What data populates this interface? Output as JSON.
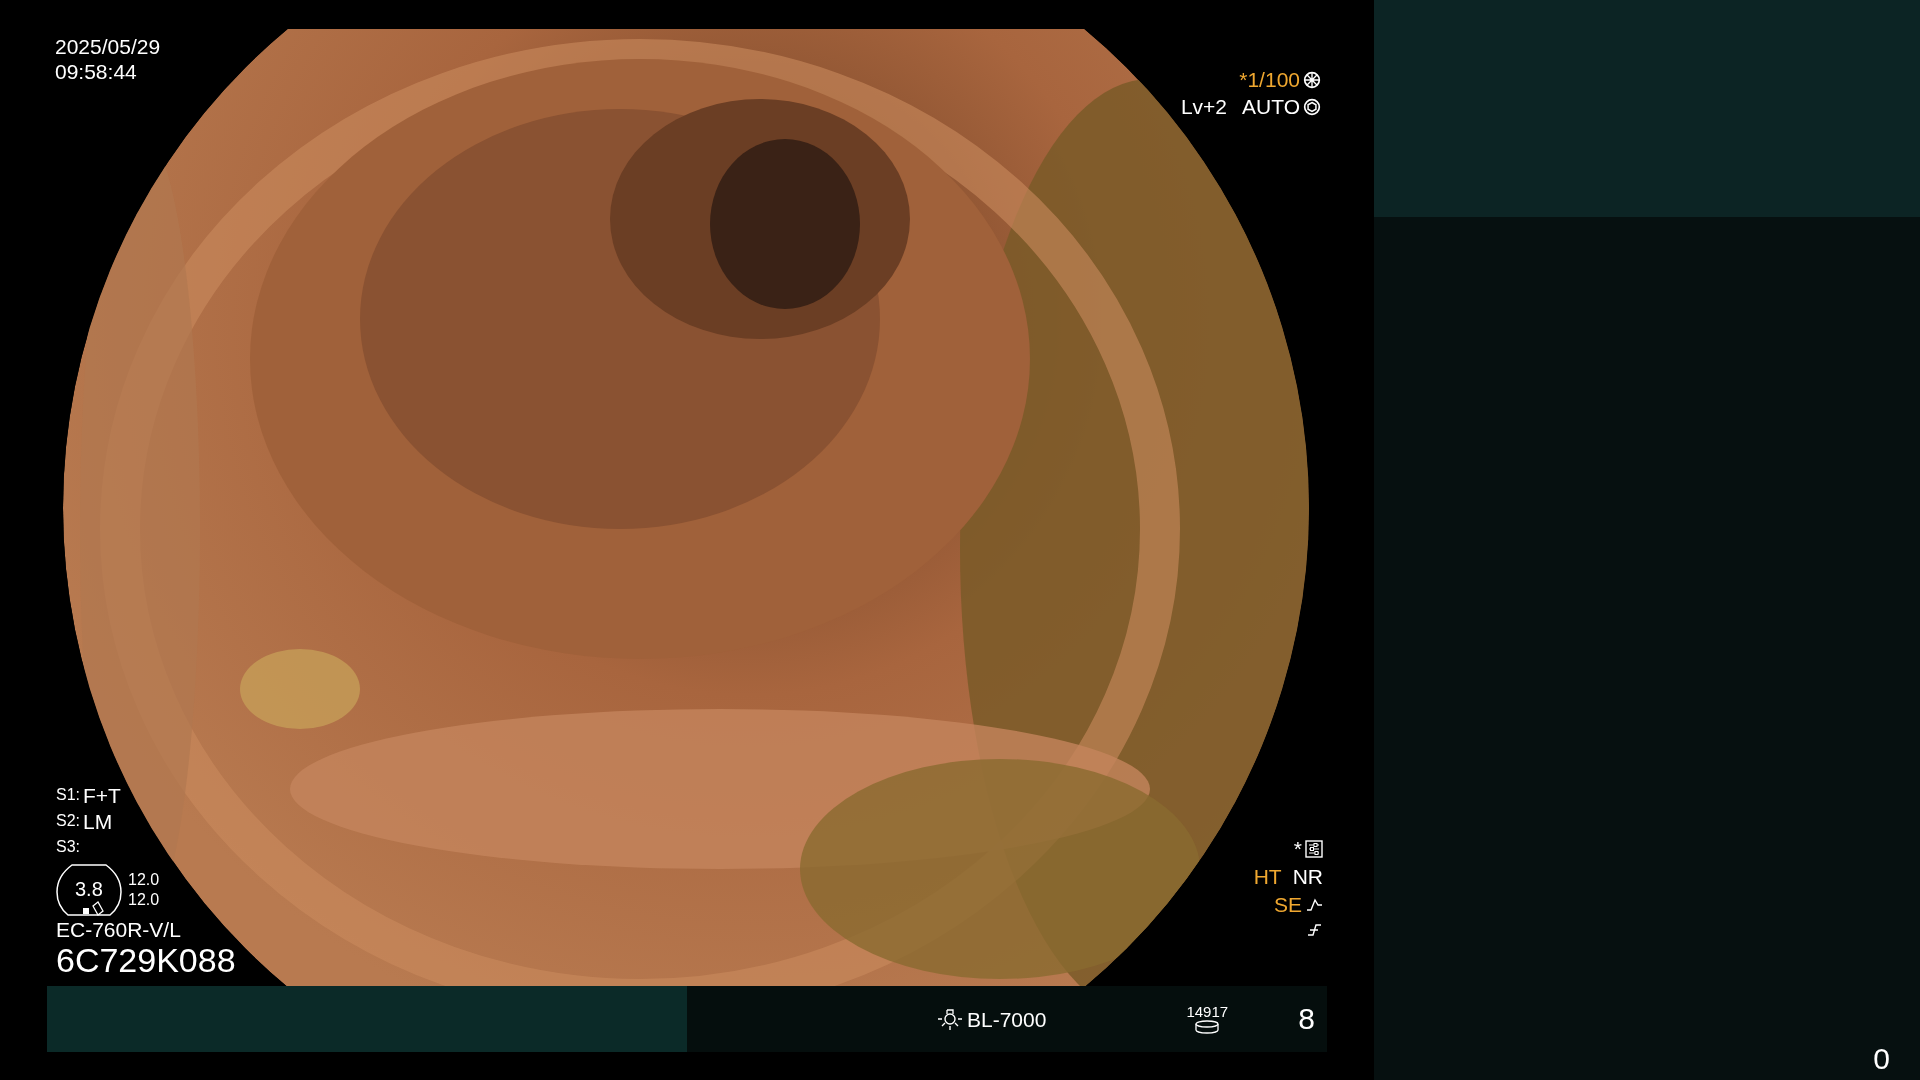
{
  "timestamp": {
    "date": "2025/05/29",
    "time": "09:58:44"
  },
  "exposure": {
    "shutter": {
      "text": "*1/100",
      "highlighted": true
    },
    "level": "Lv+2",
    "mode": "AUTO"
  },
  "settings": [
    {
      "label": "S1:",
      "value": "F+T"
    },
    {
      "label": "S2:",
      "value": "LM"
    },
    {
      "label": "S3:"
    }
  ],
  "scope_gauge": {
    "value": "3.8",
    "readings": [
      "12.0",
      "12.0"
    ]
  },
  "scope_model": "EC-760R-V/L",
  "serial": "6C729K088",
  "image_flags": {
    "marker": "*",
    "items": [
      {
        "label": "HT",
        "highlighted": true
      },
      {
        "label": "NR",
        "highlighted": false
      }
    ],
    "se": {
      "label": "SE",
      "highlighted": true
    }
  },
  "bottom_bar": {
    "light_source": "BL-7000",
    "counter": "14917",
    "number": "8"
  },
  "right_panel": {
    "counter": "0"
  }
}
